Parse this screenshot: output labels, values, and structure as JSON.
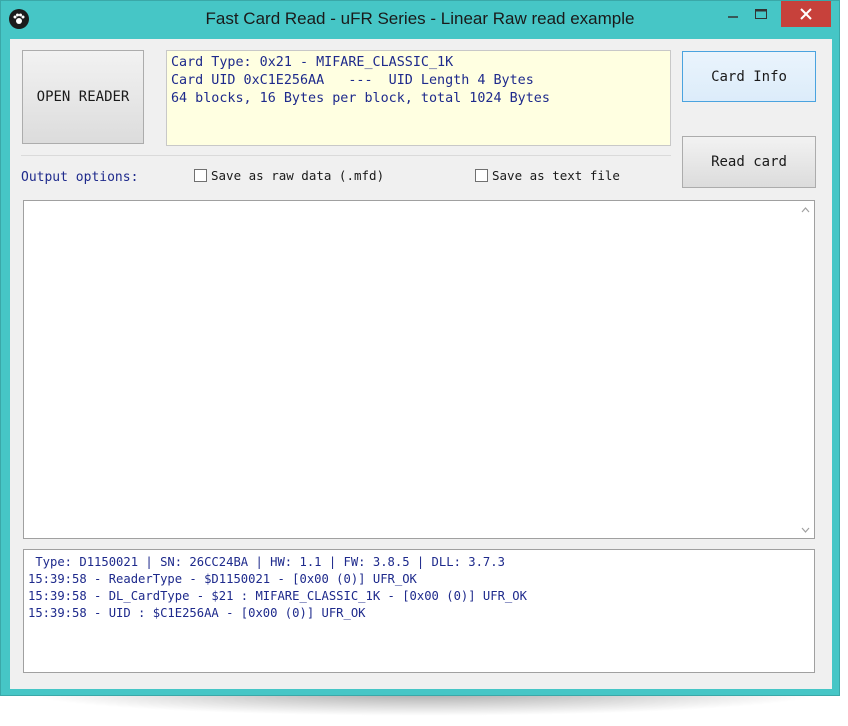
{
  "window": {
    "title": "Fast Card Read - uFR Series - Linear Raw read example",
    "app_icon": "paw-icon",
    "controls": [
      "minimize-icon",
      "maximize-icon",
      "close-icon"
    ]
  },
  "buttons": {
    "open_reader": "OPEN READER",
    "card_info": "Card Info",
    "read_card": "Read card"
  },
  "card_info_lines": [
    "Card Type: 0x21 - MIFARE_CLASSIC_1K",
    "Card UID 0xC1E256AA   ---  UID Length 4 Bytes",
    "64 blocks, 16 Bytes per block, total 1024 Bytes"
  ],
  "output_options": {
    "label": "Output options:",
    "save_raw": "Save as raw data (.mfd)",
    "save_raw_checked": false,
    "save_text": "Save as text file",
    "save_text_checked": false
  },
  "output_text": "",
  "log_lines": [
    " Type: D1150021 | SN: 26CC24BA | HW: 1.1 | FW: 3.8.5 | DLL: 3.7.3",
    "15:39:58 - ReaderType - $D1150021 - [0x00 (0)] UFR_OK",
    "15:39:58 - DL_CardType - $21 : MIFARE_CLASSIC_1K - [0x00 (0)] UFR_OK",
    "15:39:58 - UID : $C1E256AA - [0x00 (0)] UFR_OK"
  ],
  "colors": {
    "window_frame": "#46c6c6",
    "close_button": "#c7413b",
    "info_background": "#ffffe1",
    "text_blue": "#1e2a8c"
  }
}
